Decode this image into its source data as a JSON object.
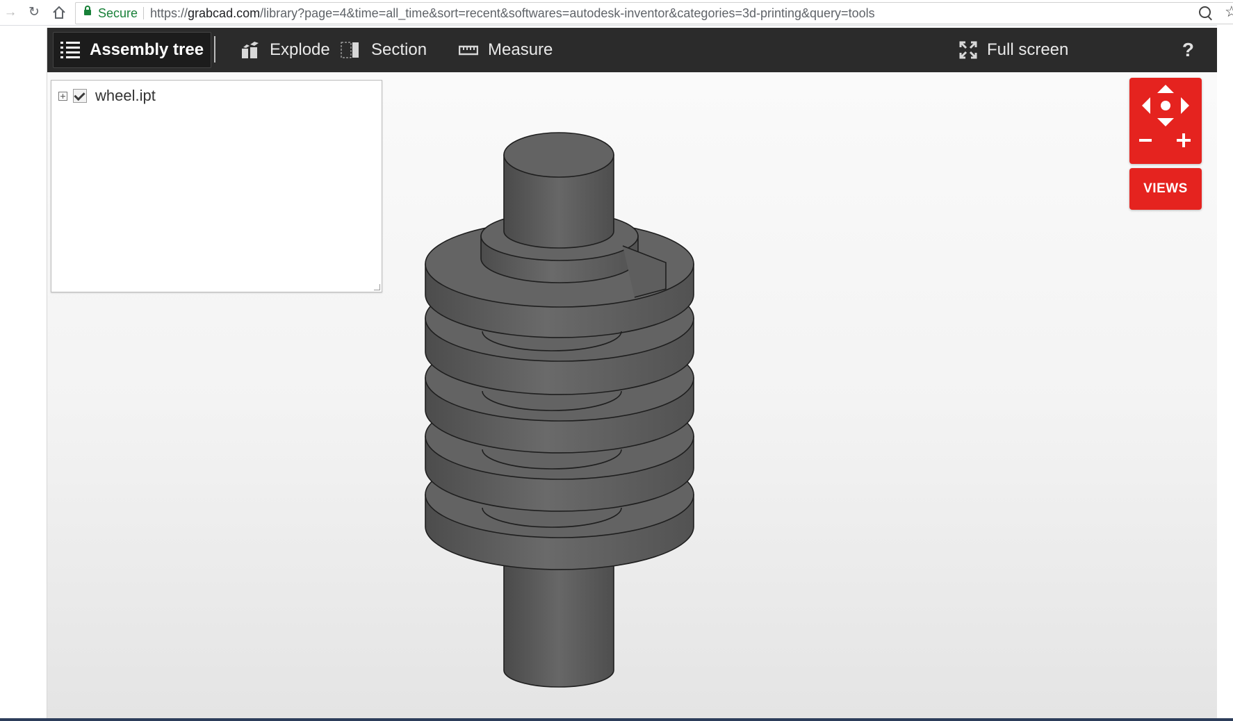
{
  "browser": {
    "back_icon": "arrow-right-icon",
    "reload_icon": "reload-icon",
    "home_icon": "home-icon",
    "secure_label": "Secure",
    "url_scheme": "https://",
    "url_host": "grabcad.com",
    "url_rest": "/library?page=4&time=all_time&sort=recent&softwares=autodesk-inventor&categories=3d-printing&query=tools"
  },
  "toolbar": {
    "assembly_tree": "Assembly tree",
    "explode": "Explode",
    "section": "Section",
    "measure": "Measure",
    "full_screen": "Full screen",
    "help": "?"
  },
  "tree": {
    "items": [
      {
        "label": "wheel.ipt",
        "checked": true
      }
    ]
  },
  "controls": {
    "views_label": "VIEWS"
  },
  "help_bubble": {
    "label": "?"
  },
  "colors": {
    "toolbar_bg": "#2b2b2b",
    "accent_red": "#e5231f",
    "model_gray": "#5c5c5c"
  }
}
